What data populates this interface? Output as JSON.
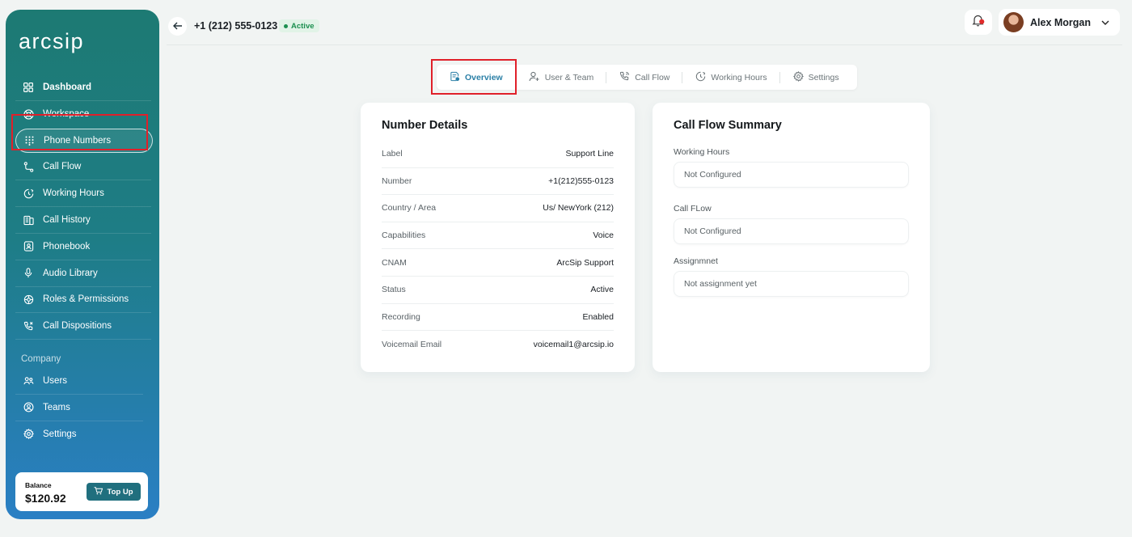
{
  "sidebar": {
    "logo": "arcsip",
    "nav": [
      {
        "label": "Dashboard",
        "icon": "grid-icon"
      },
      {
        "label": "Workspace",
        "icon": "lifebuoy-icon"
      },
      {
        "label": "Phone Numbers",
        "icon": "dialpad-icon"
      },
      {
        "label": "Call Flow",
        "icon": "flow-icon"
      },
      {
        "label": "Working Hours",
        "icon": "clock-icon"
      },
      {
        "label": "Call History",
        "icon": "history-icon"
      },
      {
        "label": "Phonebook",
        "icon": "contact-book-icon"
      },
      {
        "label": "Audio Library",
        "icon": "microphone-icon"
      },
      {
        "label": "Roles & Permissions",
        "icon": "shield-icon"
      },
      {
        "label": "Call Dispositions",
        "icon": "phone-icon"
      }
    ],
    "company_label": "Company",
    "company_nav": [
      {
        "label": "Users",
        "icon": "users-icon"
      },
      {
        "label": "Teams",
        "icon": "team-icon"
      },
      {
        "label": "Settings",
        "icon": "gear-icon"
      }
    ],
    "balance": {
      "label": "Balance",
      "value": "$120.92",
      "button": "Top Up"
    }
  },
  "header": {
    "phone": "+1 (212) 555-0123",
    "status": "Active",
    "user_name": "Alex Morgan"
  },
  "tabs": [
    {
      "label": "Overview",
      "active": true
    },
    {
      "label": "User & Team"
    },
    {
      "label": "Call Flow"
    },
    {
      "label": "Working Hours"
    },
    {
      "label": "Settings"
    }
  ],
  "number_details": {
    "title": "Number Details",
    "rows": [
      {
        "key": "Label",
        "value": "Support Line"
      },
      {
        "key": "Number",
        "value": "+1(212)555-0123"
      },
      {
        "key": "Country / Area",
        "value": "Us/ NewYork (212)"
      },
      {
        "key": "Capabilities",
        "value": "Voice"
      },
      {
        "key": "CNAM",
        "value": "ArcSip Support"
      },
      {
        "key": "Status",
        "value": "Active"
      },
      {
        "key": "Recording",
        "value": "Enabled"
      },
      {
        "key": "Voicemail Email",
        "value": "voicemail1@arcsip.io"
      }
    ]
  },
  "call_flow_summary": {
    "title": "Call Flow Summary",
    "fields": [
      {
        "label": "Working Hours",
        "value": "Not Configured"
      },
      {
        "label": "Call FLow",
        "value": "Not Configured"
      },
      {
        "label": "Assignmnet",
        "value": "Not assignment yet"
      }
    ]
  },
  "colors": {
    "accent": "#206f7e",
    "active_tab": "#2a7fa6",
    "status_green": "#1b8f4f",
    "highlight": "#e0202a"
  }
}
